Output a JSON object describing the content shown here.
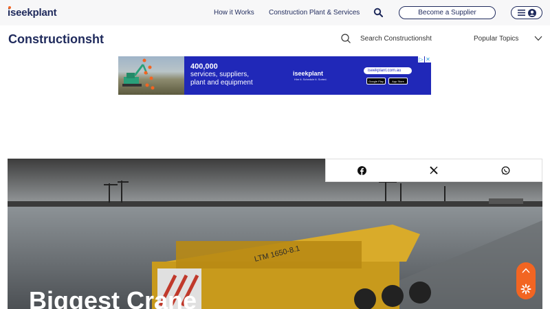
{
  "header": {
    "logo": "iseekplant",
    "nav": [
      "How it Works",
      "Construction Plant & Services"
    ],
    "supplier_button": "Become a Supplier"
  },
  "subheader": {
    "brand": "Constructionsht",
    "search_label": "Search Constructionsht",
    "topics_label": "Popular Topics"
  },
  "ad": {
    "headline": "400,000",
    "lines": [
      "services, suppliers,",
      "plant and equipment"
    ],
    "logo": "iseekplant",
    "tagline": "Hire it. Schedule it. Sorted.",
    "url": "iseekplant.com.au",
    "stores": [
      "Google Play",
      "App Store"
    ]
  },
  "hero": {
    "title": "Biggest Crane",
    "crane_label": "LTM 1650-8.1"
  },
  "share": {
    "icons": [
      "facebook-icon",
      "x-icon",
      "whatsapp-icon"
    ]
  },
  "colors": {
    "navy": "#1f2a5c",
    "accent": "#f26522",
    "ad_blue": "#2028b8"
  }
}
